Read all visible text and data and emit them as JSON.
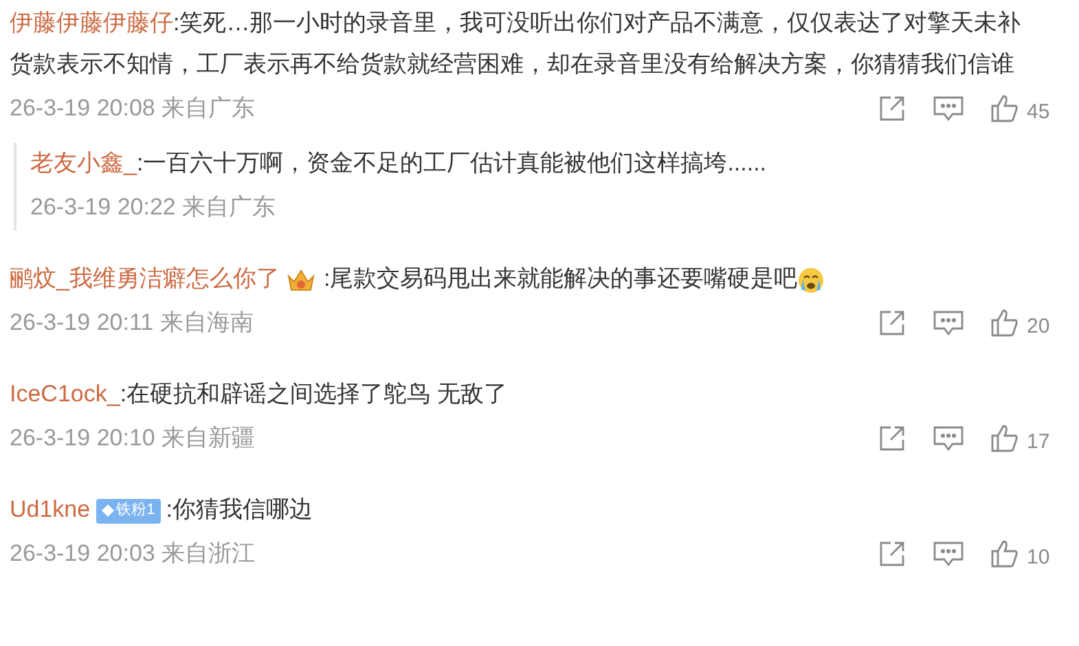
{
  "comments": [
    {
      "kind": "comment",
      "user": "伊藤伊藤伊藤仔",
      "text": ":笑死…那一小时的录音里，我可没听出你们对产品不满意，仅仅表达了对擎天未补货款表示不知情，工厂表示再不给货款就经营困难，却在录音里没有给解决方案，你猜猜我们信谁",
      "time": "26-3-19 20:08",
      "location": "来自广东",
      "likes": "45"
    },
    {
      "kind": "reply",
      "user": "老友小鑫_",
      "text": ":一百六十万啊，资金不足的工厂估计真能被他们这样搞垮......",
      "time": "26-3-19 20:22",
      "location": "来自广东"
    },
    {
      "kind": "comment",
      "user": "鹂炆_我维勇洁癖怎么你了",
      "badge": {
        "kind": "crown"
      },
      "text": ":尾款交易码甩出来就能解决的事还要嘴硬是吧",
      "trailing_icon": {
        "kind": "crying"
      },
      "time": "26-3-19 20:11",
      "location": "来自海南",
      "likes": "20"
    },
    {
      "kind": "comment",
      "user": "IceC1ock_",
      "text": ":在硬抗和辟谣之间选择了鸵鸟 无敌了",
      "time": "26-3-19 20:10",
      "location": "来自新疆",
      "likes": "17"
    },
    {
      "kind": "comment",
      "user": "Ud1kne",
      "badge": {
        "kind": "fan",
        "label": "铁粉1"
      },
      "text": ":你猜我信哪边",
      "time": "26-3-19 20:03",
      "location": "来自浙江",
      "likes": "10"
    }
  ]
}
